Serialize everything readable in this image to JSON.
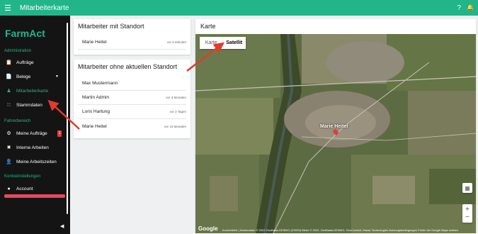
{
  "topbar": {
    "title": "Mitarbeiterkarte",
    "help": "?",
    "bell": "🔔"
  },
  "sidebar": {
    "logo": "FarmAct",
    "sections": [
      {
        "title": "Administration"
      },
      {
        "title": "Fahrerbereich"
      },
      {
        "title": "Kontoeinstellungen"
      }
    ],
    "items": [
      {
        "label": "Aufträge",
        "icon": "📋"
      },
      {
        "label": "Belege",
        "icon": "📄",
        "dropdown": "▼"
      },
      {
        "label": "Mitarbeiterkarte",
        "icon": "♟"
      },
      {
        "label": "Stammdaten",
        "icon": "∷"
      },
      {
        "label": "Meine Aufträge",
        "icon": "⚙",
        "badge": "1"
      },
      {
        "label": "Interne Arbeiten",
        "icon": "✖"
      },
      {
        "label": "Meine Arbeitszeiten",
        "icon": "👤"
      },
      {
        "label": "Account",
        "icon": "●"
      }
    ],
    "collapse": "◀"
  },
  "with_location": {
    "title": "Mitarbeiter mit Standort",
    "rows": [
      {
        "name": "Marie Heitel",
        "ago": "vor 5 Minuten"
      }
    ]
  },
  "without_location": {
    "title": "Mitarbeiter ohne aktuellen Standort",
    "rows": [
      {
        "name": "Max Mustermann",
        "ago": ""
      },
      {
        "name": "Martin Admin",
        "ago": "vor 3 Monaten"
      },
      {
        "name": "Loris Hartung",
        "ago": "vor 2 Tagen"
      },
      {
        "name": "Marie Heitel",
        "ago": "vor 10 Monaten"
      }
    ]
  },
  "map": {
    "title": "Karte",
    "type_options": [
      "Karte",
      "Satellit"
    ],
    "selected_type": "Satellit",
    "marker_label": "Marie Heitel",
    "zoom_in": "+",
    "zoom_out": "−",
    "google": "Google",
    "attribution": "Kurzbefehle | Kartendaten © 2022 GeoBasis-DE/BKG (©2009) Bilder © 2022, GeoBasis-DE/BKG, GeoContent, Maxar Technologies   Nutzungsbedingungen   Fehler bei Google Maps melden"
  }
}
